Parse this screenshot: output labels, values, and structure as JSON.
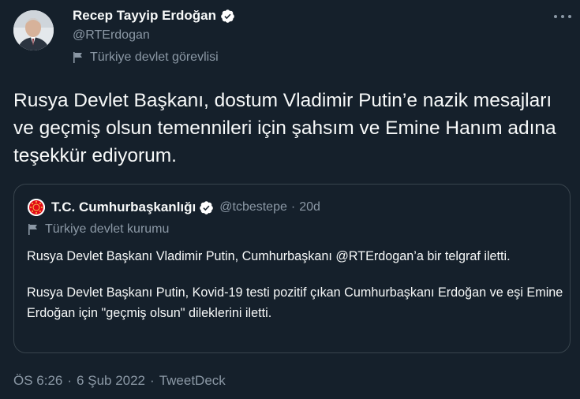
{
  "author": {
    "name": "Recep Tayyip Erdoğan",
    "handle": "@RTErdogan",
    "label": "Türkiye devlet görevlisi"
  },
  "tweet": {
    "text": "Rusya Devlet Başkanı, dostum Vladimir Putin’e nazik mesajları ve geçmiş olsun temennileri için şahsım ve Emine Hanım adına teşekkür ediyorum."
  },
  "quote": {
    "name": "T.C. Cumhurbaşkanlığı",
    "handle": "@tcbestepe",
    "separator": "·",
    "age": "20d",
    "label": "Türkiye devlet kurumu",
    "paragraphs": [
      "Rusya Devlet Başkanı Vladimir Putin, Cumhurbaşkanı @RTErdogan’a bir telgraf iletti.",
      "Rusya Devlet Başkanı Putin, Kovid-19 testi pozitif çıkan Cumhurbaşkanı Erdoğan ve eşi Emine Erdoğan için \"geçmiş olsun\" dileklerini iletti."
    ]
  },
  "meta": {
    "time": "ÖS 6:26",
    "date": "6 Şub 2022",
    "source": "TweetDeck",
    "separator": "·"
  },
  "colors": {
    "background": "#15202b",
    "text": "#f7f9f9",
    "secondary": "#8b98a5",
    "verified": "#ffffff",
    "border": "#38444d"
  },
  "icons": {
    "verified": "verified-badge-icon",
    "government_label": "flag-icon",
    "more": "more-options-icon"
  }
}
